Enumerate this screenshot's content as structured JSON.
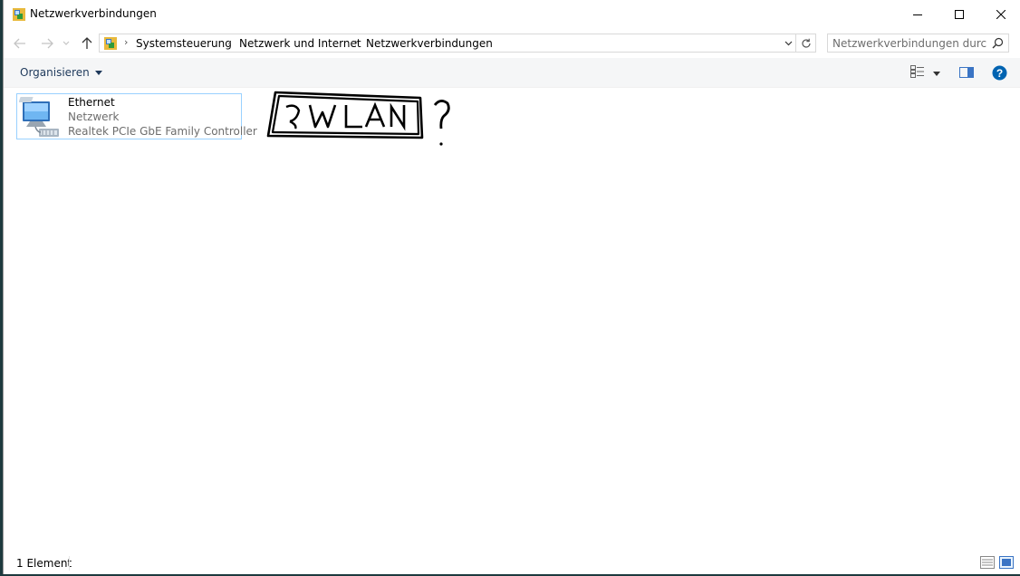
{
  "window": {
    "title": "Netzwerkverbindungen"
  },
  "breadcrumb": [
    "Systemsteuerung",
    "Netzwerk und Internet",
    "Netzwerkverbindungen"
  ],
  "search": {
    "placeholder": "Netzwerkverbindungen durch..."
  },
  "commandbar": {
    "organize_label": "Organisieren"
  },
  "items": [
    {
      "name": "Ethernet",
      "network": "Netzwerk",
      "device": "Realtek PCIe GbE Family Controller",
      "icon": "ethernet-adapter-icon"
    }
  ],
  "annotation": {
    "text": "WLAN",
    "mark": "?"
  },
  "status": {
    "count": "1 Element"
  },
  "colors": {
    "accent": "#0063b1",
    "selection_border": "#99d1ff",
    "link": "#1e395b"
  }
}
